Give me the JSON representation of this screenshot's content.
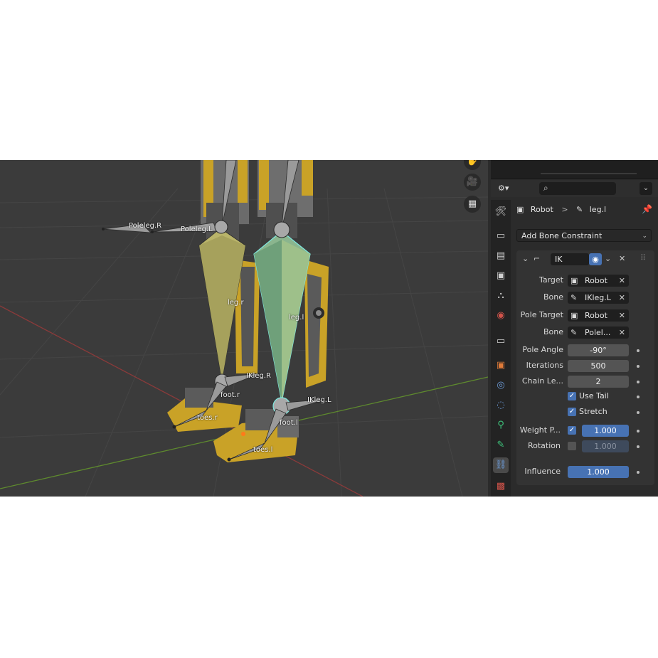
{
  "viewport": {
    "tool_icons": [
      "hand-icon",
      "camera-icon",
      "grid-icon"
    ],
    "bone_labels": {
      "poleleg_r": "Poleleg.R",
      "poleleg_l": "Poleleg.L",
      "leg_r": "leg.r",
      "leg_l": "leg.l",
      "ikleg_r": "IKleg.R",
      "ikleg_l": "IKleg.L",
      "foot_r": "foot.r",
      "foot_l": "foot.l",
      "toes_r": "toes.r",
      "toes_l": "toes.l"
    }
  },
  "properties": {
    "breadcrumb": {
      "object": "Robot",
      "separator": ">",
      "bone": "leg.l"
    },
    "add_constraint": "Add Bone Constraint",
    "constraint": {
      "name": "IK",
      "target_label": "Target",
      "target_value": "Robot",
      "bone_label": "Bone",
      "bone_value": "IKleg.L",
      "pole_target_label": "Pole Target",
      "pole_target_value": "Robot",
      "pole_bone_label": "Bone",
      "pole_bone_value": "Polel...",
      "pole_angle_label": "Pole Angle",
      "pole_angle_value": "-90°",
      "iterations_label": "Iterations",
      "iterations_value": "500",
      "chain_length_label": "Chain Le...",
      "chain_length_value": "2",
      "use_tail_label": "Use Tail",
      "use_tail_checked": true,
      "stretch_label": "Stretch",
      "stretch_checked": true,
      "weight_position_label": "Weight P...",
      "weight_position_checked": true,
      "weight_position_value": "1.000",
      "rotation_label": "Rotation",
      "rotation_checked": false,
      "rotation_value": "1.000",
      "influence_label": "Influence",
      "influence_value": "1.000"
    }
  },
  "colors": {
    "accent": "#4772b3",
    "selected_bone": "#6fa07a",
    "bone": "#b9b46a",
    "robot_body": "#c9a227"
  }
}
